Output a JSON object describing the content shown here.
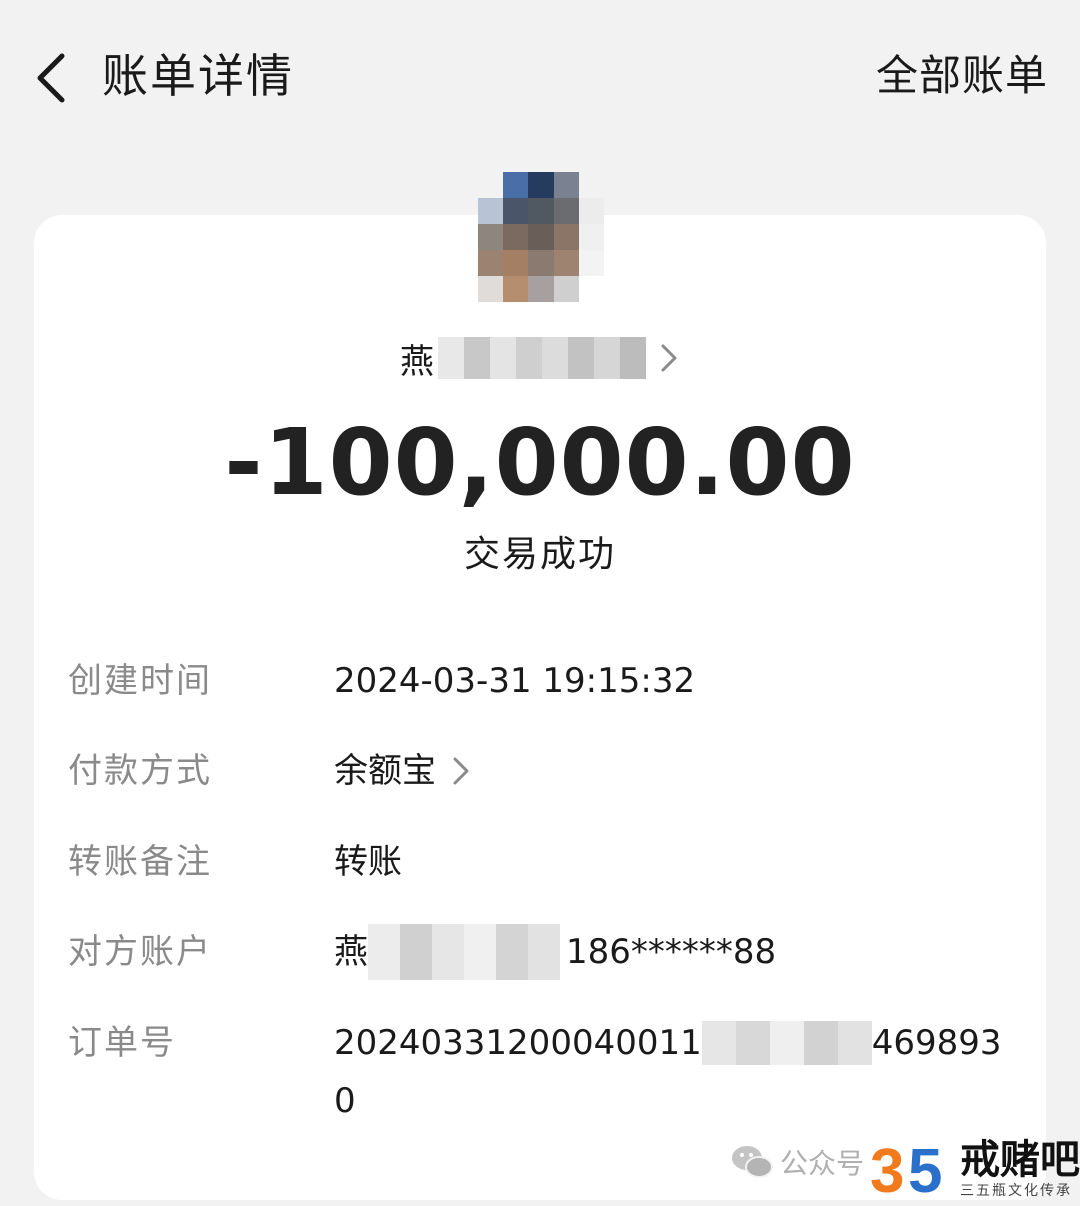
{
  "header": {
    "title": "账单详情",
    "all_bills_label": "全部账单"
  },
  "payee": {
    "name_visible": "燕"
  },
  "transaction": {
    "amount": "-100,000.00",
    "status": "交易成功"
  },
  "details": {
    "created_time": {
      "label": "创建时间",
      "value": "2024-03-31 19:15:32"
    },
    "payment_method": {
      "label": "付款方式",
      "value": "余额宝"
    },
    "remark": {
      "label": "转账备注",
      "value": "转账"
    },
    "counterparty": {
      "label": "对方账户",
      "name_visible": "燕",
      "phone": "186******88"
    },
    "order_no": {
      "label": "订单号",
      "prefix": "20240331200040011",
      "suffix": "469893",
      "line2": "0"
    }
  },
  "watermark": {
    "text": "公众号",
    "brand": "戒赌吧",
    "subtitle": "三五瓶文化传承"
  },
  "icons": {
    "back": "chevron-left-icon",
    "name_chevron": "chevron-right-icon",
    "method_chevron": "chevron-right-icon",
    "wechat": "wechat-icon"
  },
  "colors": {
    "background": "#f2f2f2",
    "card": "#ffffff",
    "label": "#8a8a8a",
    "text": "#1a1a1a"
  }
}
